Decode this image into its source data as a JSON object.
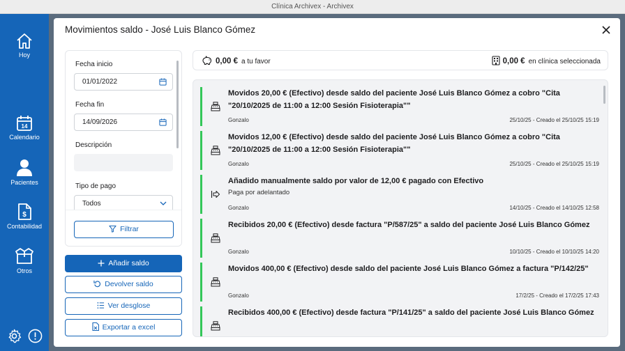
{
  "window": {
    "title": "Clínica Archivex - Archivex"
  },
  "sidebar": {
    "items": [
      {
        "label": "Hoy",
        "icon": "home-icon"
      },
      {
        "label": "Calendario",
        "icon": "calendar-icon",
        "day": "14"
      },
      {
        "label": "Pacientes",
        "icon": "user-icon"
      },
      {
        "label": "Contabilidad",
        "icon": "invoice-icon"
      },
      {
        "label": "Otros",
        "icon": "box-icon"
      }
    ],
    "bottom": [
      {
        "icon": "gear-icon"
      },
      {
        "icon": "info-icon"
      }
    ]
  },
  "modal": {
    "title": "Movimientos saldo - José Luis Blanco Gómez",
    "filters": {
      "start_label": "Fecha inicio",
      "start_value": "01/01/2022",
      "end_label": "Fecha fin",
      "end_value": "14/09/2026",
      "description_label": "Descripción",
      "description_value": "",
      "payment_type_label": "Tipo de pago",
      "payment_type_value": "Todos",
      "filter_button": "Filtrar"
    },
    "actions": {
      "add": "Añadir saldo",
      "refund": "Devolver saldo",
      "breakdown": "Ver desglose",
      "export": "Exportar a excel"
    },
    "balance": {
      "favor_amount": "0,00 €",
      "favor_label": "a tu favor",
      "clinic_amount": "0,00 €",
      "clinic_label": "en clínica seleccionada"
    },
    "movements": [
      {
        "title": "Movidos 20,00 € (Efectivo) desde saldo del paciente José Luis Blanco Gómez a cobro \"Cita \"20/10/2025 de 11:00 a 12:00 Sesión Fisioterapia\"\"",
        "subtitle": "",
        "user": "Gonzalo",
        "date": "25/10/25 - Creado el 25/10/25 15:19",
        "icon": "cash-register-icon",
        "accent": "#34c759"
      },
      {
        "title": "Movidos 12,00 € (Efectivo) desde saldo del paciente José Luis Blanco Gómez a cobro \"Cita \"20/10/2025 de 11:00 a 12:00 Sesión Fisioterapia\"\"",
        "subtitle": "",
        "user": "Gonzalo",
        "date": "25/10/25 - Creado el 25/10/25 15:19",
        "icon": "cash-register-icon",
        "accent": "#34c759"
      },
      {
        "title": "Añadido manualmente saldo por valor de 12,00 € pagado con Efectivo",
        "subtitle": "Paga por adelantado",
        "user": "Gonzalo",
        "date": "14/10/25 - Creado el 14/10/25 12:58",
        "icon": "arrow-in-icon",
        "accent": "#34c759"
      },
      {
        "title": "Recibidos 20,00 € (Efectivo) desde factura \"P/587/25\" a saldo del paciente José Luis Blanco Gómez",
        "subtitle": "",
        "user": "Gonzalo",
        "date": "10/10/25 - Creado el 10/10/25 14:20",
        "icon": "cash-register-icon",
        "accent": "#34c759"
      },
      {
        "title": "Movidos 400,00 € (Efectivo) desde saldo del paciente José Luis Blanco Gómez a factura \"P/142/25\"",
        "subtitle": "",
        "user": "Gonzalo",
        "date": "17/2/25 - Creado el 17/2/25 17:43",
        "icon": "cash-register-icon",
        "accent": "#34c759"
      },
      {
        "title": "Recibidos 400,00 € (Efectivo) desde factura \"P/141/25\" a saldo del paciente José Luis Blanco Gómez",
        "subtitle": "",
        "user": "",
        "date": "",
        "icon": "cash-register-icon",
        "accent": "#34c759"
      }
    ]
  },
  "colors": {
    "brand": "#1565b8",
    "accent_green": "#34c759",
    "overlay": "#5a6b7d"
  }
}
